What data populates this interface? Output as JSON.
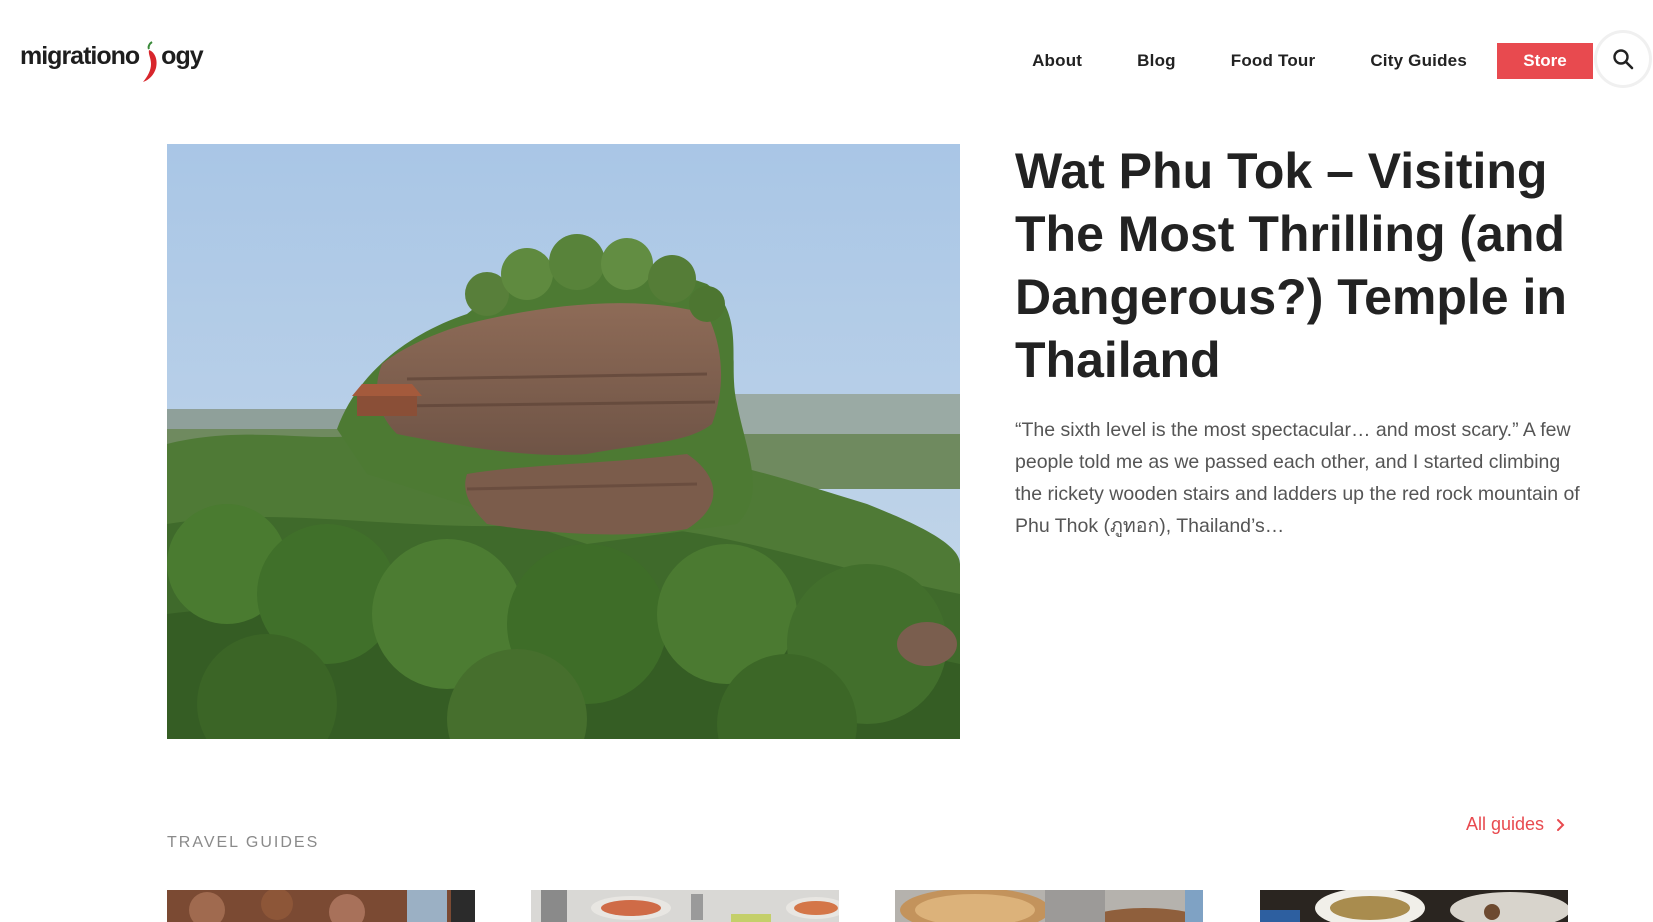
{
  "header": {
    "logo_text_left": "migrationo",
    "logo_text_right": "ogy",
    "nav": {
      "about": "About",
      "blog": "Blog",
      "food_tour": "Food Tour",
      "city_guides": "City Guides",
      "store": "Store"
    },
    "search_icon": "search-icon"
  },
  "featured": {
    "title": "Wat Phu Tok – Visiting The Most Thrilling (and Dangerous?) Temple in Thailand",
    "excerpt": "“The sixth level is the most spectacular… and most scary.” A few people told me as we passed each other, and I started climbing the rickety wooden stairs and ladders up the red rock mountain of Phu Thok (ภูทอก), Thailand’s…"
  },
  "travel_guides": {
    "label": "TRAVEL GUIDES",
    "all_link": "All guides"
  },
  "colors": {
    "accent": "#e84a4f",
    "text": "#222222",
    "muted": "#8a8a8a"
  }
}
